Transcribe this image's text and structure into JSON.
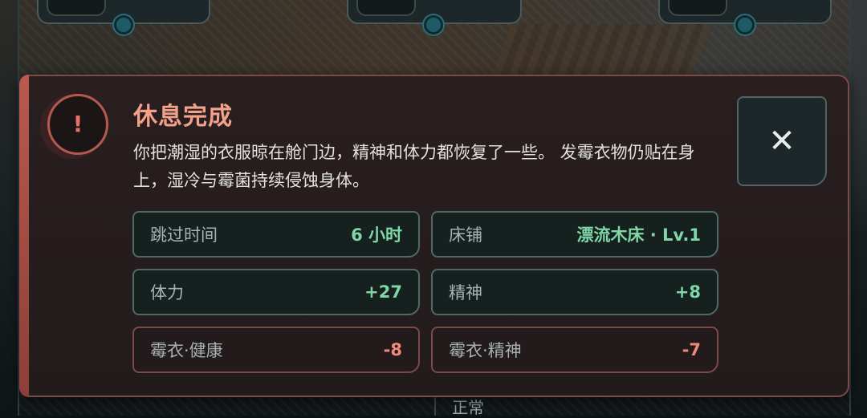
{
  "dialog": {
    "title": "休息完成",
    "message": "你把潮湿的衣服晾在舱门边，精神和体力都恢复了一些。 发霉衣物仍贴在身上，湿冷与霉菌持续侵蚀身体。",
    "close_label": "✕",
    "alert_symbol": "!",
    "stats": [
      {
        "label": "跳过时间",
        "value": "6 小时",
        "tone": "good"
      },
      {
        "label": "床铺",
        "value": "漂流木床 · Lv.1",
        "tone": "good"
      },
      {
        "label": "体力",
        "value": "+27",
        "tone": "good"
      },
      {
        "label": "精神",
        "value": "+8",
        "tone": "good"
      },
      {
        "label": "霉衣·健康",
        "value": "-8",
        "tone": "bad"
      },
      {
        "label": "霉衣·精神",
        "value": "-7",
        "tone": "bad"
      }
    ]
  },
  "background": {
    "status_text": "正常"
  },
  "colors": {
    "accent": "#b75a50",
    "title": "#f3a289",
    "positive": "#7fd6a6",
    "negative": "#f18a7a"
  },
  "icons": {
    "alert": "alert-icon",
    "close": "close-icon",
    "map_pin": "map-pin-icon"
  }
}
